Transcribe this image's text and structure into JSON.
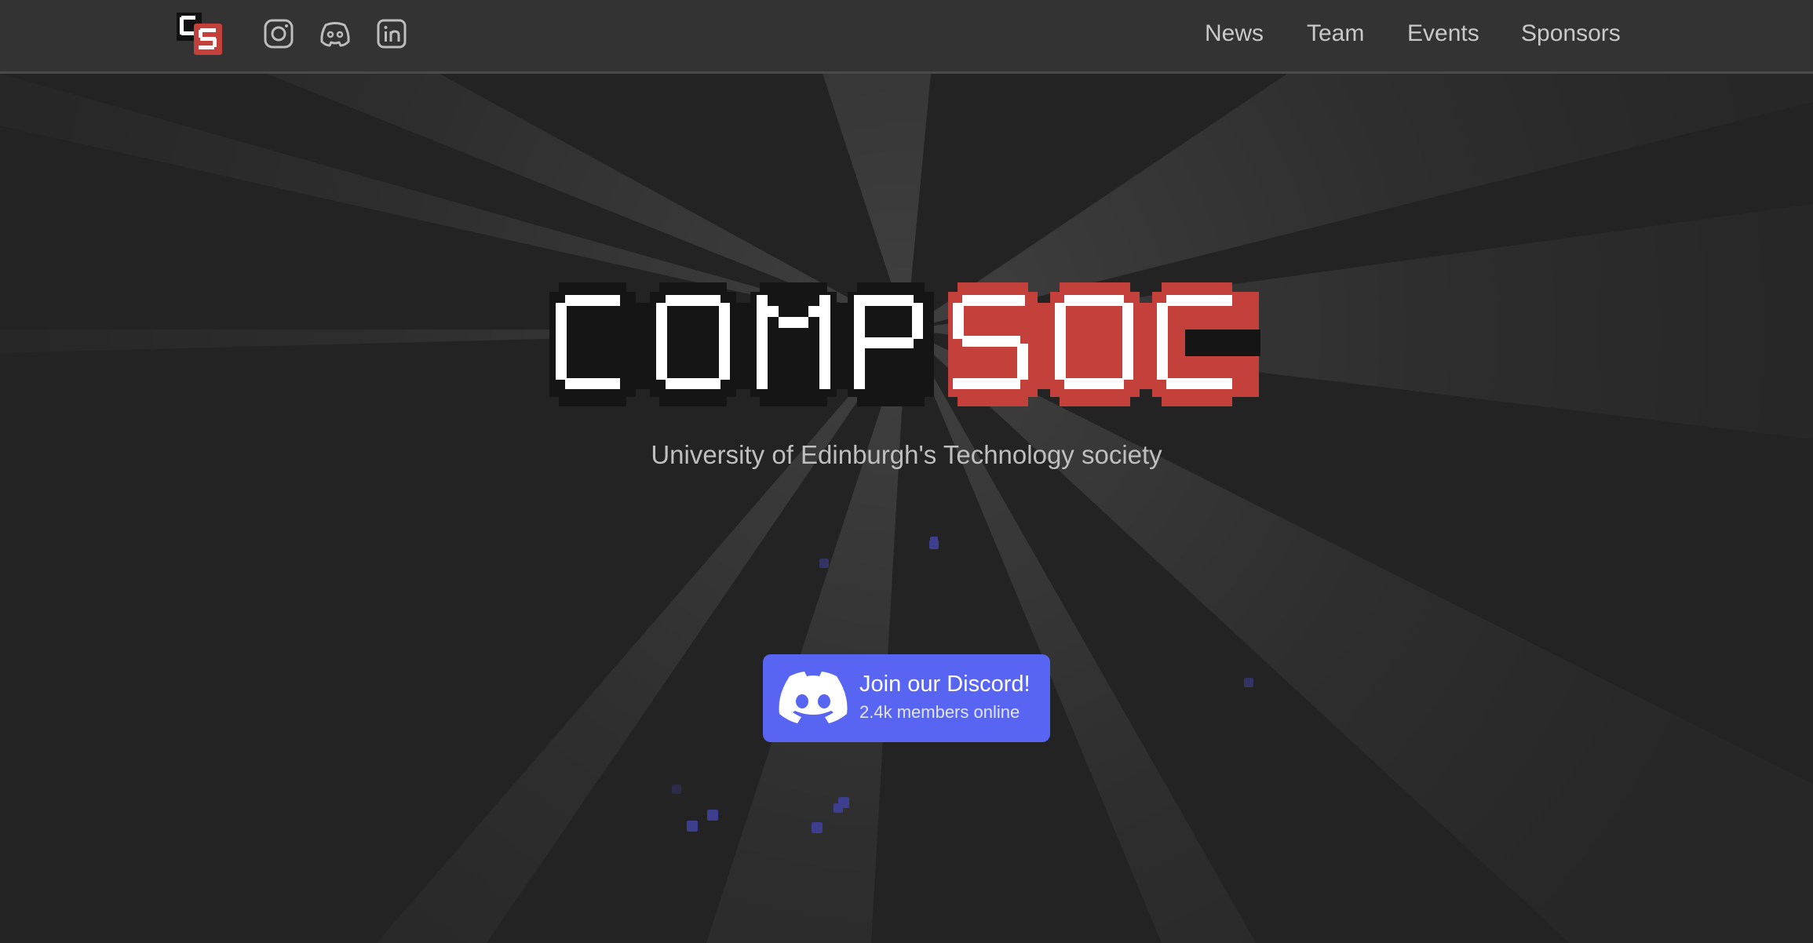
{
  "nav": {
    "logo_name": "compsoc-logo",
    "social": [
      {
        "icon": "instagram-icon"
      },
      {
        "icon": "discord-icon"
      },
      {
        "icon": "linkedin-icon"
      }
    ],
    "links": [
      "News",
      "Team",
      "Events",
      "Sponsors"
    ]
  },
  "hero": {
    "wordmark_text": "COMPSOC",
    "subtitle": "University of Edinburgh's Technology society"
  },
  "discord": {
    "title": "Join our Discord!",
    "members": "2.4k members online",
    "icon": "discord-icon"
  },
  "colors": {
    "background": "#232323",
    "navbar": "#333333",
    "accent_red": "#c4403a",
    "discord_blurple": "#5865f2"
  }
}
